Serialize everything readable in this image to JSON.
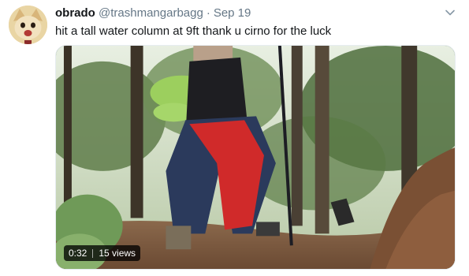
{
  "tweet": {
    "display_name": "obrado",
    "handle": "@trashmangarbagg",
    "separator": "·",
    "date": "Sep 19",
    "text": "hit a tall water column at 9ft thank u cirno for the luck",
    "more_icon": "chevron-down-icon",
    "avatar_icon": "avatar-icon"
  },
  "video": {
    "duration": "0:32",
    "views": "15 views"
  },
  "colors": {
    "text_primary": "#14171a",
    "text_secondary": "#657786",
    "overlay_bg": "#000000"
  }
}
